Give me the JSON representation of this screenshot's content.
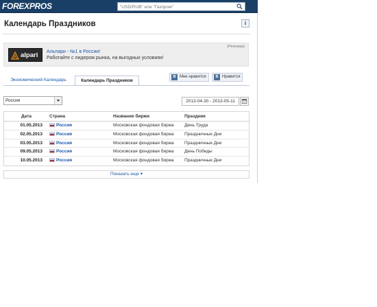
{
  "header": {
    "logo": "FOREXPROS",
    "search_placeholder": "\"USD/RUB\" или \"Газпром\""
  },
  "page": {
    "title": "Календарь Праздников"
  },
  "ad": {
    "tag": "(Реклама)",
    "logo_text": "alpari",
    "link": "Альпари - №1 в России!",
    "text": "Работайте с лидером рынка, на выгодных условиях!"
  },
  "tabs": [
    {
      "label": "Экономический Календарь",
      "active": false
    },
    {
      "label": "Календарь Праздников",
      "active": true
    }
  ],
  "social": {
    "vk_letter": "В",
    "like1": "Мне нравится",
    "like2": "Нравится"
  },
  "filters": {
    "country": "Россия",
    "date_range": "2013-04-30 - 2013-05-11"
  },
  "table": {
    "headers": {
      "date": "Дата",
      "country": "Страна",
      "exchange": "Название биржи",
      "holiday": "Праздник"
    },
    "rows": [
      {
        "date": "01.05.2013",
        "country": "Россия",
        "exchange": "Московская фондовая биржа",
        "holiday": "День Труда"
      },
      {
        "date": "02.05.2013",
        "country": "Россия",
        "exchange": "Московская фондовая биржа",
        "holiday": "Праздничные Дни"
      },
      {
        "date": "03.05.2013",
        "country": "Россия",
        "exchange": "Московская фондовая биржа",
        "holiday": "Праздничные Дни"
      },
      {
        "date": "09.05.2013",
        "country": "Россия",
        "exchange": "Московская фондовая биржа",
        "holiday": "День Победы"
      },
      {
        "date": "10.05.2013",
        "country": "Россия",
        "exchange": "Московская фондовая биржа",
        "holiday": "Праздничные Дни"
      }
    ]
  },
  "show_more": "Показать еще ▾",
  "colors": {
    "header_bg": "#1a3f66",
    "link": "#1a56a8"
  }
}
